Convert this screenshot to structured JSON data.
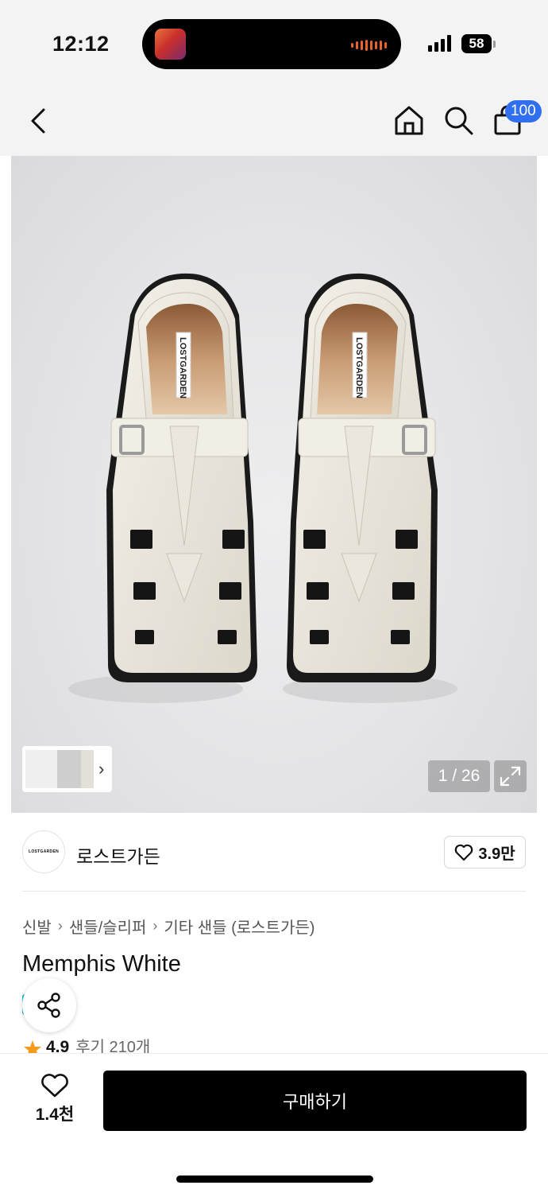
{
  "status_bar": {
    "time": "12:12",
    "battery": "58"
  },
  "nav": {
    "cart_badge": "100"
  },
  "gallery": {
    "page_counter": "1 / 26",
    "product_label_text": "LOSTGARDEN"
  },
  "brand": {
    "logo_text": "LOSTGARDEN",
    "name": "로스트가든",
    "like_count": "3.9만"
  },
  "breadcrumb": [
    "신발",
    "샌들/슬리퍼",
    "기타 샌들 (로스트가든)"
  ],
  "product": {
    "title": "Memphis White",
    "rating": "4.9",
    "reviews": "후기 210개"
  },
  "bottom_bar": {
    "wish_count": "1.4천",
    "buy_label": "구매하기"
  },
  "colors": {
    "accent_blue": "#2f6ff0",
    "star": "#f59a1b",
    "buy_button": "#000000"
  }
}
